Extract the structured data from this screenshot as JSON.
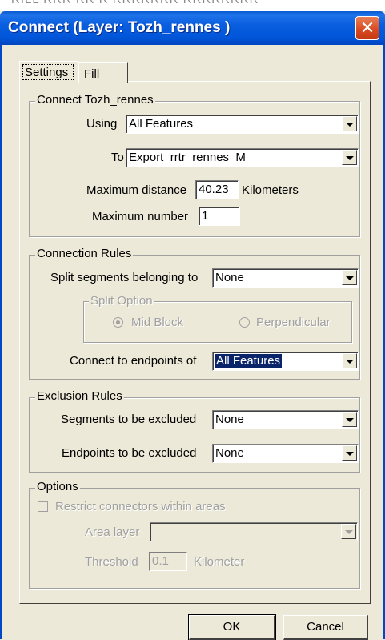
{
  "window": {
    "title": "Connect (Layer: Tozh_rennes )",
    "close_glyph": "✕",
    "top_strip_text": "RILL RRR RR  R RRRRRRR  RRRRRRRR"
  },
  "tabs": [
    {
      "label": "Settings",
      "active": true
    },
    {
      "label": "Fill",
      "active": false
    }
  ],
  "connect_group": {
    "legend": "Connect Tozh_rennes",
    "using_label": "Using",
    "using_value": "All Features",
    "to_label": "To",
    "to_value": "Export_rrtr_rennes_M",
    "max_distance_label": "Maximum distance",
    "max_distance_value": "40.23",
    "max_distance_unit": "Kilometers",
    "max_number_label": "Maximum number",
    "max_number_value": "1"
  },
  "connection_rules": {
    "legend": "Connection Rules",
    "split_label": "Split segments belonging to",
    "split_value": "None",
    "split_option_legend": "Split Option",
    "mid_block_label": "Mid Block",
    "perpendicular_label": "Perpendicular",
    "mid_block_selected": true,
    "endpoints_label": "Connect to endpoints of",
    "endpoints_value": "All Features"
  },
  "exclusion_rules": {
    "legend": "Exclusion Rules",
    "segments_label": "Segments to be excluded",
    "segments_value": "None",
    "endpoints_label": "Endpoints to be excluded",
    "endpoints_value": "None"
  },
  "options": {
    "legend": "Options",
    "restrict_label": "Restrict connectors within areas",
    "restrict_checked": false,
    "area_layer_label": "Area layer",
    "area_layer_value": "",
    "threshold_label": "Threshold",
    "threshold_value": "0.1",
    "threshold_unit": "Kilometer"
  },
  "buttons": {
    "ok": "OK",
    "cancel": "Cancel"
  },
  "icons": [
    "close-icon",
    "chevron-down-icon"
  ],
  "colors": {
    "titlebar": "#0055d8",
    "dialog_bg": "#ece9d8",
    "close_button": "#d8481e",
    "selection": "#0a246a"
  }
}
